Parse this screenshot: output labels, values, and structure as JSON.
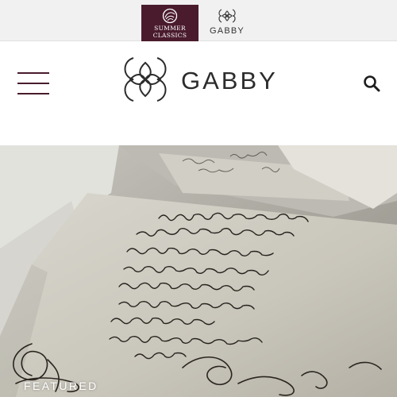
{
  "brand_switcher": {
    "summer_classics": {
      "label": "SUMMER\nCLASSICS",
      "bg_color": "#4a1b2d"
    },
    "gabby": {
      "label": "GABBY"
    }
  },
  "header": {
    "logo_text": "GABBY",
    "menu_icon": "hamburger-menu-icon",
    "search_icon": "search-icon",
    "accent_color": "#4a1b2d"
  },
  "hero": {
    "label": "FEATURED",
    "image_subject": "antique handwritten letters"
  }
}
